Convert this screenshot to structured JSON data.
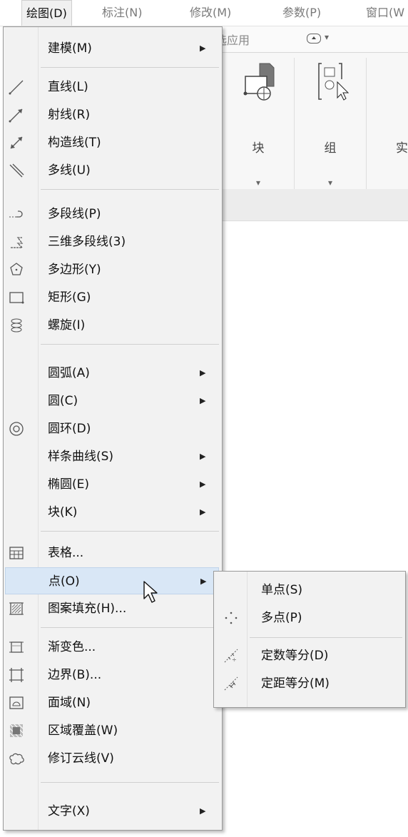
{
  "menubar": {
    "items": [
      "绘图(D)",
      "标注(N)",
      "修改(M)",
      "参数(P)",
      "窗口(W"
    ]
  },
  "ribbon": {
    "tab_text": "选应用",
    "panels": [
      {
        "label": "块",
        "icon": "block-insert-icon"
      },
      {
        "label": "组",
        "icon": "group-icon"
      },
      {
        "label": "实",
        "icon": "utility-icon"
      }
    ]
  },
  "menu": {
    "items": [
      {
        "label": "建模(M)",
        "icon": "",
        "submenu": true
      },
      {
        "label": "直线(L)",
        "icon": "line-icon"
      },
      {
        "label": "射线(R)",
        "icon": "ray-icon"
      },
      {
        "label": "构造线(T)",
        "icon": "construction-line-icon"
      },
      {
        "label": "多线(U)",
        "icon": "multiline-icon"
      },
      {
        "label": "多段线(P)",
        "icon": "polyline-icon"
      },
      {
        "label": "三维多段线(3)",
        "icon": "3d-polyline-icon"
      },
      {
        "label": "多边形(Y)",
        "icon": "polygon-icon"
      },
      {
        "label": "矩形(G)",
        "icon": "rectangle-icon"
      },
      {
        "label": "螺旋(I)",
        "icon": "helix-icon"
      },
      {
        "label": "圆弧(A)",
        "icon": "",
        "submenu": true
      },
      {
        "label": "圆(C)",
        "icon": "",
        "submenu": true
      },
      {
        "label": "圆环(D)",
        "icon": "donut-icon"
      },
      {
        "label": "样条曲线(S)",
        "icon": "",
        "submenu": true
      },
      {
        "label": "椭圆(E)",
        "icon": "",
        "submenu": true
      },
      {
        "label": "块(K)",
        "icon": "",
        "submenu": true
      },
      {
        "label": "表格...",
        "icon": "table-icon"
      },
      {
        "label": "点(O)",
        "icon": "",
        "submenu": true,
        "highlighted": true
      },
      {
        "label": "图案填充(H)...",
        "icon": "hatch-icon"
      },
      {
        "label": "渐变色...",
        "icon": "gradient-icon"
      },
      {
        "label": "边界(B)...",
        "icon": "boundary-icon"
      },
      {
        "label": "面域(N)",
        "icon": "region-icon"
      },
      {
        "label": "区域覆盖(W)",
        "icon": "wipeout-icon"
      },
      {
        "label": "修订云线(V)",
        "icon": "revcloud-icon"
      },
      {
        "label": "文字(X)",
        "icon": "",
        "submenu": true
      }
    ]
  },
  "submenu_point": {
    "items": [
      {
        "label": "单点(S)",
        "icon": ""
      },
      {
        "label": "多点(P)",
        "icon": "multiple-points-icon"
      },
      {
        "label": "定数等分(D)",
        "icon": "divide-icon"
      },
      {
        "label": "定距等分(M)",
        "icon": "measure-icon"
      }
    ]
  },
  "colors": {
    "highlight": "#d9e7f6",
    "menu_bg": "#f2f2f2"
  }
}
